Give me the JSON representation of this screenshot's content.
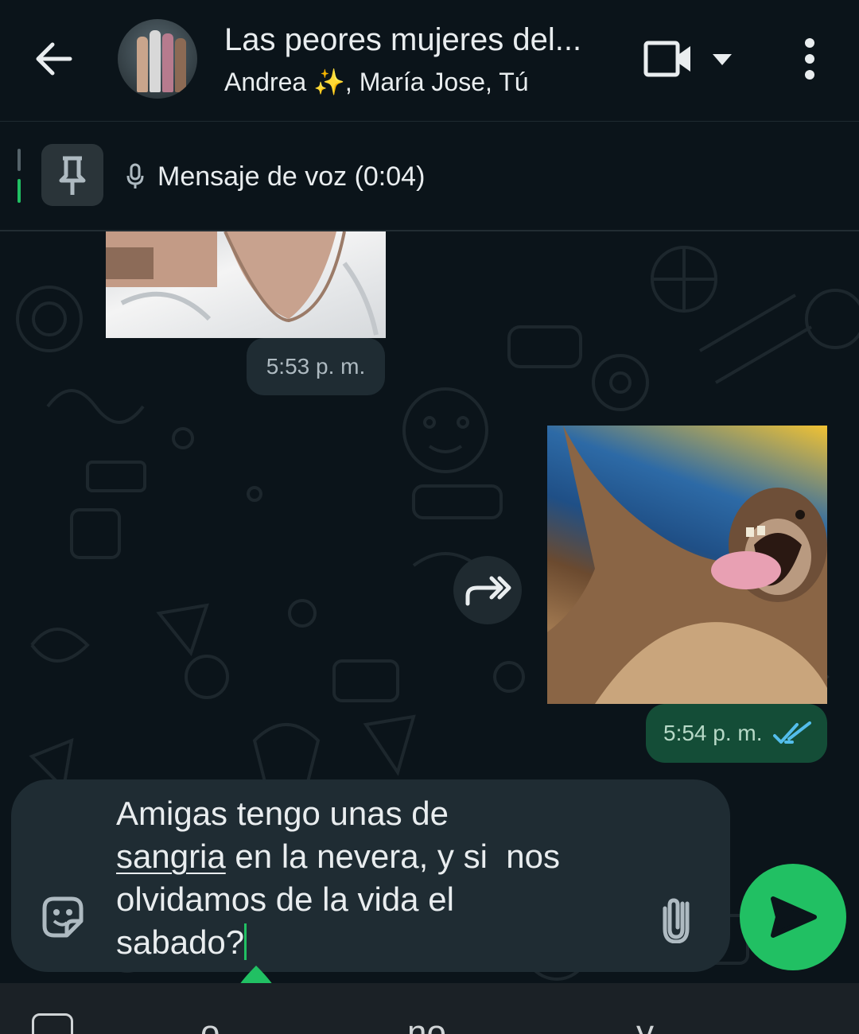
{
  "header": {
    "title": "Las peores mujeres del...",
    "subtitle": "Andrea ✨, María Jose, Tú",
    "icons": [
      "back-arrow-icon",
      "group-avatar",
      "video-call-icon",
      "chevron-down-icon",
      "more-vert-icon"
    ]
  },
  "pinned": {
    "text": "Mensaje de voz (0:04)",
    "icons": [
      "pin-icon",
      "mic-icon"
    ]
  },
  "messages": {
    "received_time": "5:53 p. m.",
    "sent_time": "5:54 p. m."
  },
  "composer": {
    "line1": "Amigas tengo unas de",
    "line2_underlined": "sangria",
    "line2_rest": " en la nevera, y si  nos",
    "line3": "olvidamos de la vida el",
    "line4": "sabado?"
  },
  "keyboard": {
    "suggestions": [
      "o",
      "no",
      "y"
    ],
    "more": "..."
  },
  "colors": {
    "background": "#0b141a",
    "accent_green": "#21c063",
    "sent_bubble": "#144d37",
    "received_bubble": "#1f2c33",
    "read_ticks": "#53bdeb"
  }
}
